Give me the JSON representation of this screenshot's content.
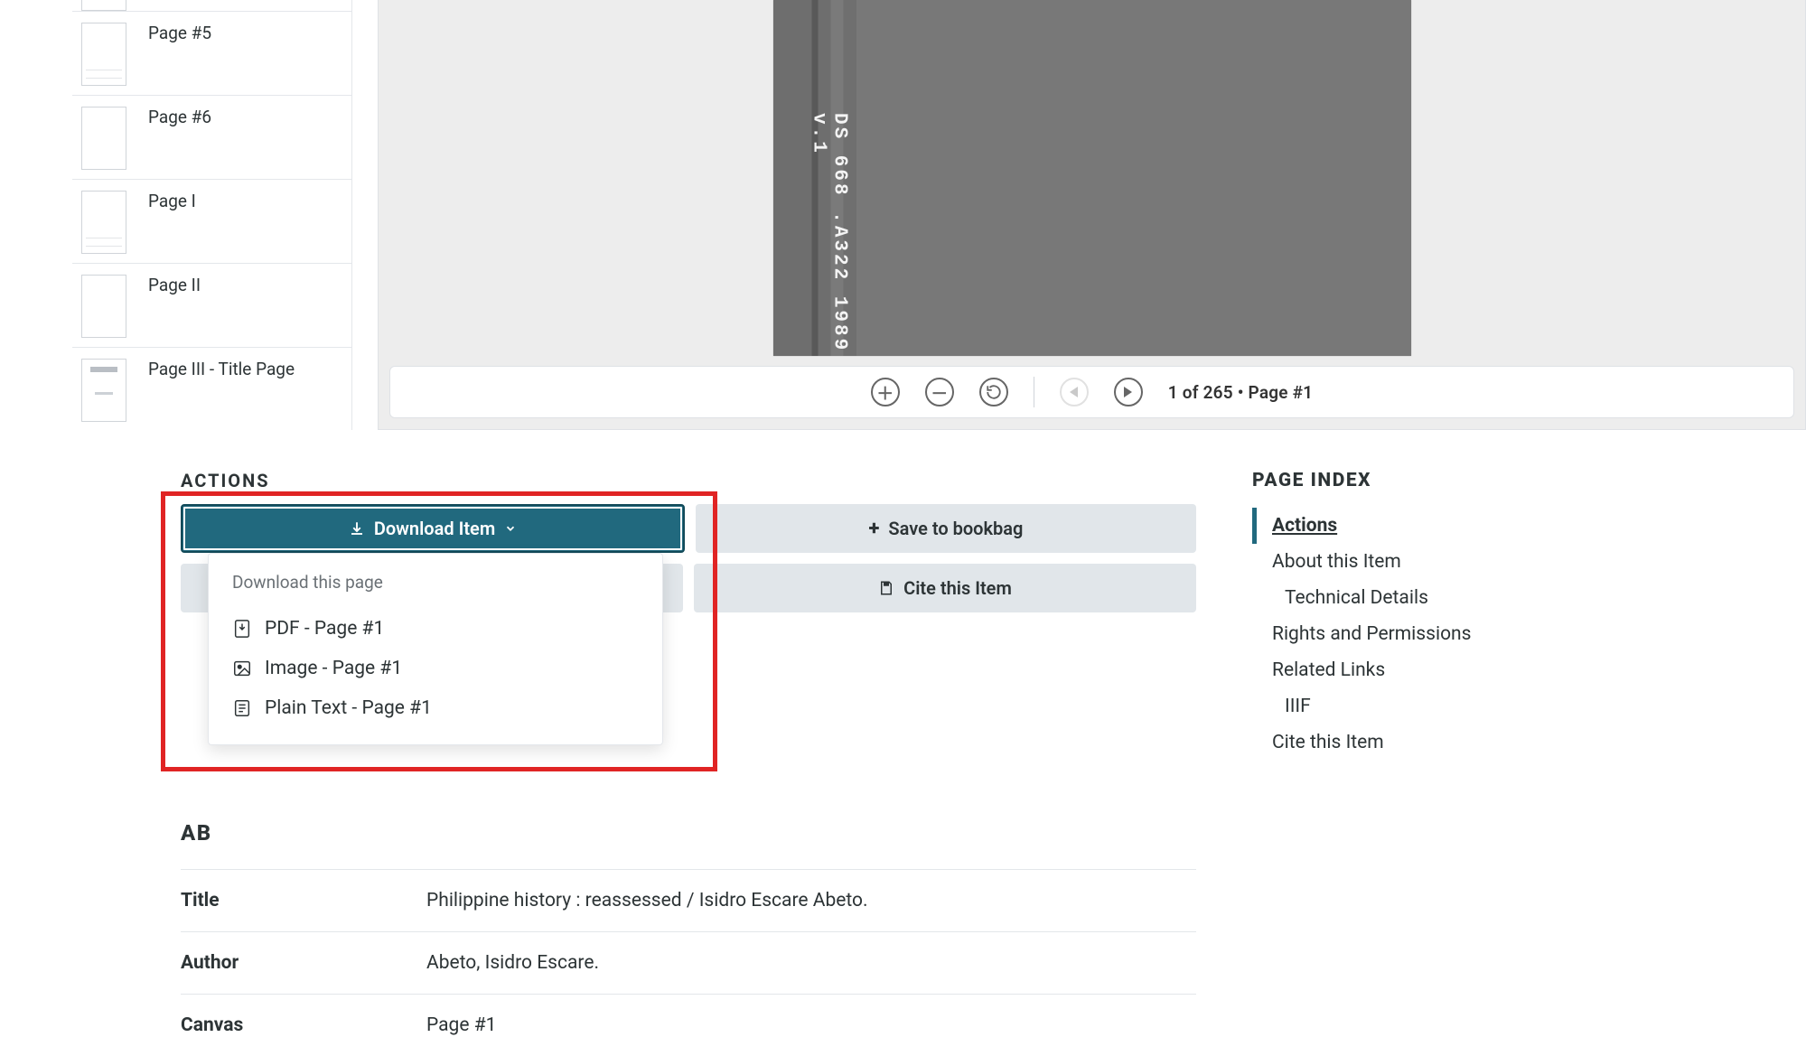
{
  "thumbnails": [
    {
      "label": ""
    },
    {
      "label": "Page #5"
    },
    {
      "label": "Page #6"
    },
    {
      "label": "Page I"
    },
    {
      "label": "Page II"
    },
    {
      "label": "Page III - Title Page"
    }
  ],
  "viewer": {
    "spine": "DS 668 .A322 1989 v.1",
    "status": "1 of 265 • Page #1"
  },
  "actions": {
    "header": "ACTIONS",
    "download": "Download Item",
    "savebag": "Save to bookbag",
    "cite": "Cite this Item",
    "dropdown": {
      "header": "Download this page",
      "pdf": "PDF - Page #1",
      "image": "Image - Page #1",
      "text": "Plain Text - Page #1"
    }
  },
  "meta": {
    "header": "AB",
    "title_label": "Title",
    "title_val": "Philippine history : reassessed / Isidro Escare Abeto.",
    "author_label": "Author",
    "author_val": "Abeto, Isidro Escare.",
    "canvas_label": "Canvas",
    "canvas_val": "Page #1"
  },
  "pageindex": {
    "header": "PAGE INDEX",
    "items": {
      "actions": "Actions",
      "about": "About this Item",
      "tech": "Technical Details",
      "rights": "Rights and Permissions",
      "related": "Related Links",
      "iiif": "IIIF",
      "cite": "Cite this Item"
    }
  }
}
